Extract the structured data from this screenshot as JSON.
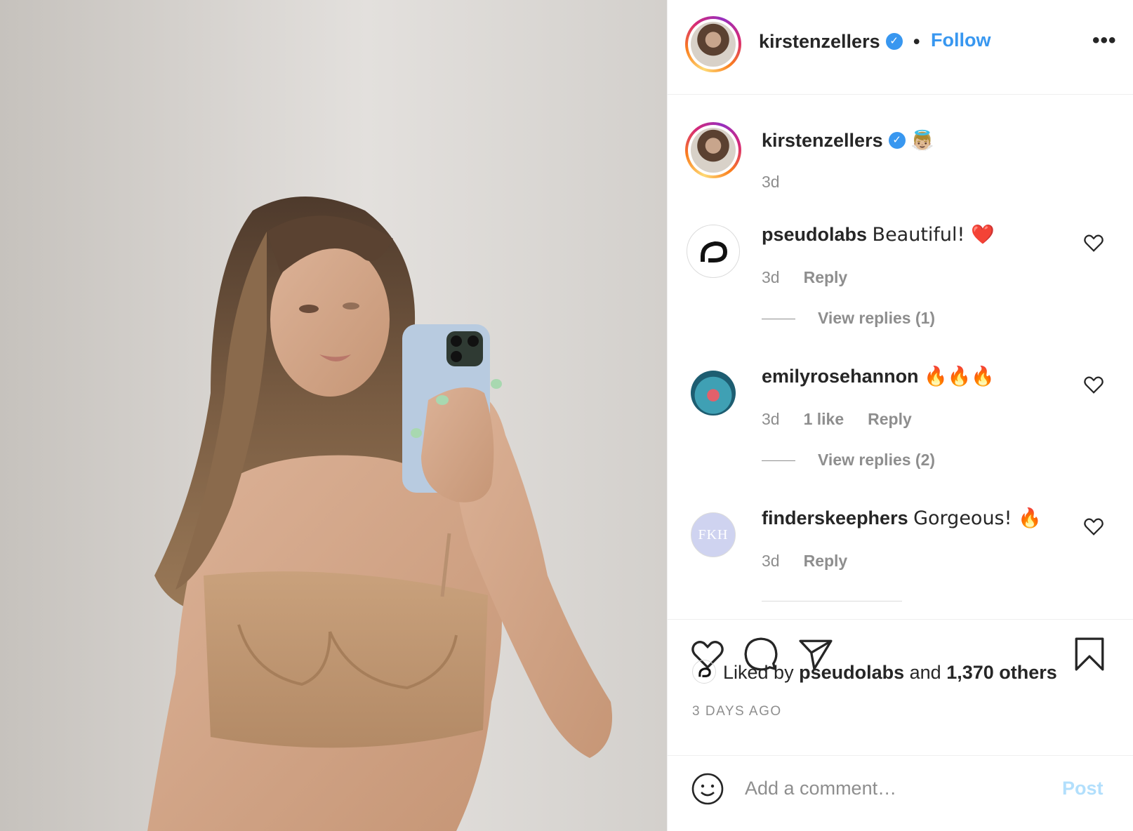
{
  "post": {
    "author": "kirstenzellers",
    "verified_icon": "verified-badge-icon",
    "separator": "•",
    "follow_label": "Follow",
    "more_label": "•••"
  },
  "caption": {
    "username": "kirstenzellers",
    "text": "👼🏼",
    "age": "3d"
  },
  "comments": [
    {
      "username": "pseudolabs",
      "text": "Beautiful! ❤️",
      "age": "3d",
      "likes": "",
      "reply_label": "Reply",
      "view_replies": "View replies (1)"
    },
    {
      "username": "emilyrosehannon",
      "text": "🔥🔥🔥",
      "age": "3d",
      "likes": "1 like",
      "reply_label": "Reply",
      "view_replies": "View replies (2)"
    },
    {
      "username": "finderskeephers",
      "text": "Gorgeous! 🔥",
      "age": "3d",
      "likes": "",
      "reply_label": "Reply",
      "avatar_text": "FKH"
    }
  ],
  "likes": {
    "prefix": "Liked by",
    "by_user": "pseudolabs",
    "and": "and",
    "others": "1,370 others"
  },
  "timestamp": "3 DAYS AGO",
  "add_comment": {
    "placeholder": "Add a comment…",
    "post_label": "Post"
  },
  "colors": {
    "link_blue": "#3897f0",
    "post_disabled": "#b2dffc",
    "muted_text": "#8e8e8e"
  }
}
